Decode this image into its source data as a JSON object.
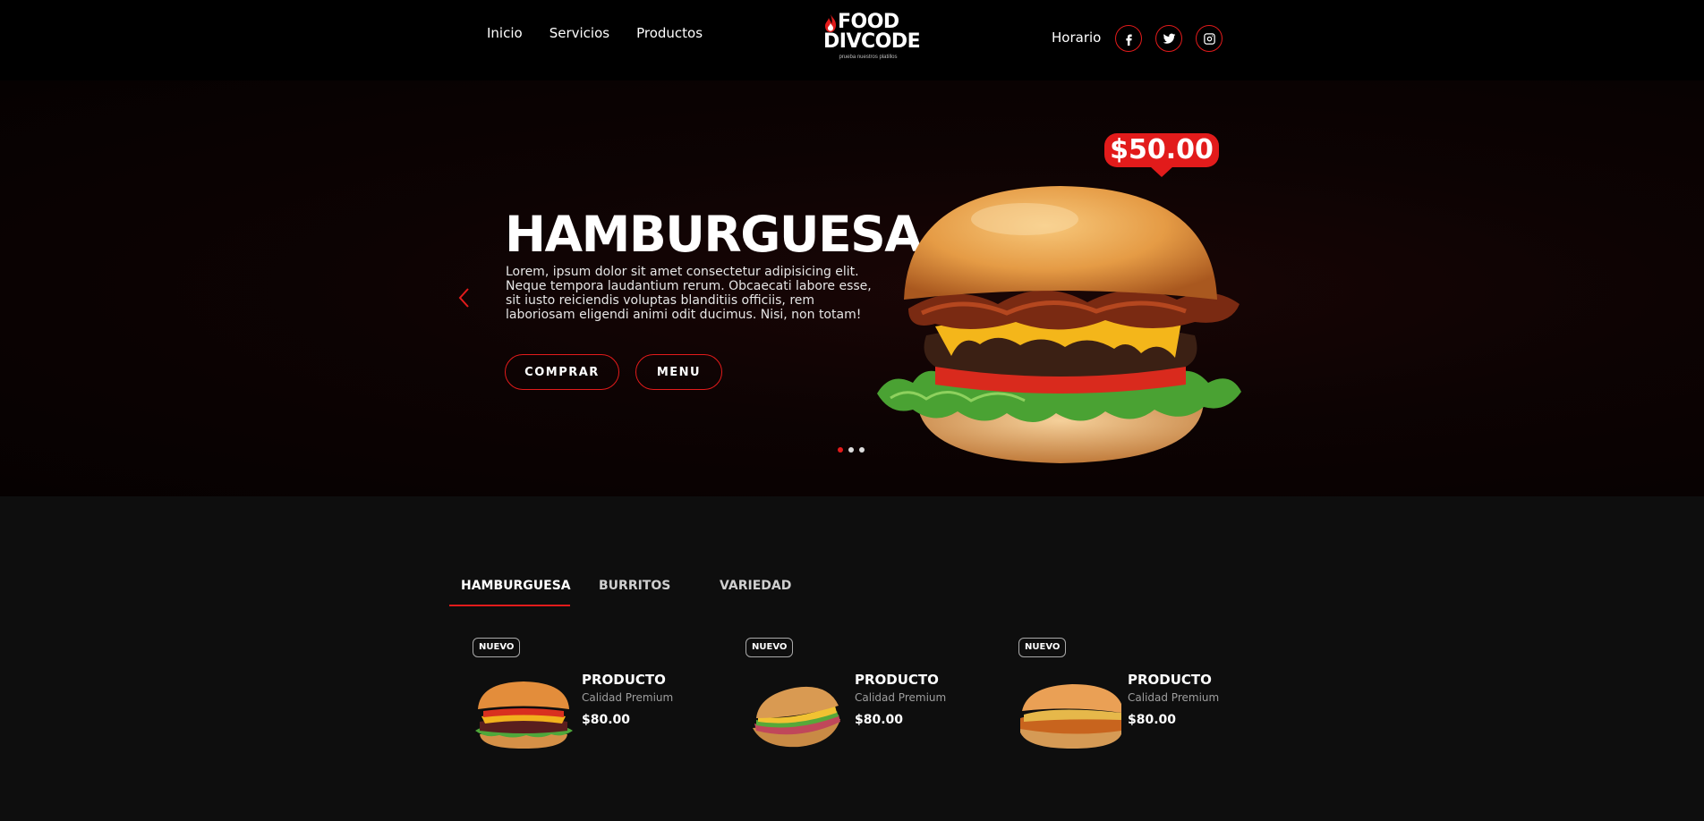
{
  "nav": {
    "items": [
      {
        "label": "Inicio"
      },
      {
        "label": "Servicios"
      },
      {
        "label": "Productos"
      }
    ],
    "horario": "Horario"
  },
  "logo": {
    "line1": "FOOD",
    "line2": "DIVCODE",
    "tagline": "prueba nuestros platillos"
  },
  "social": [
    "facebook-icon",
    "twitter-icon",
    "instagram-icon"
  ],
  "hero": {
    "title": "HAMBURGUESA",
    "description": "Lorem, ipsum dolor sit amet consectetur adipisicing elit. Neque tempora laudantium rerum. Obcaecati labore esse, sit iusto reiciendis voluptas blanditiis officiis, rem laboriosam eligendi animi odit ducimus. Nisi, non totam!",
    "price": "$50.00",
    "buy_label": "COMPRAR",
    "menu_label": "MENU",
    "slides": 3,
    "active_slide": 1
  },
  "tabs": [
    {
      "label": "HAMBURGUESA",
      "active": true
    },
    {
      "label": "BURRITOS",
      "active": false
    },
    {
      "label": "VARIEDAD",
      "active": false
    }
  ],
  "products": [
    {
      "badge": "NUEVO",
      "name": "PRODUCTO",
      "subtitle": "Calidad Premium",
      "price": "$80.00"
    },
    {
      "badge": "NUEVO",
      "name": "PRODUCTO",
      "subtitle": "Calidad Premium",
      "price": "$80.00"
    },
    {
      "badge": "NUEVO",
      "name": "PRODUCTO",
      "subtitle": "Calidad Premium",
      "price": "$80.00"
    }
  ],
  "colors": {
    "accent": "#e21b1b",
    "background": "#000000",
    "section_background": "#0e0e0e"
  }
}
